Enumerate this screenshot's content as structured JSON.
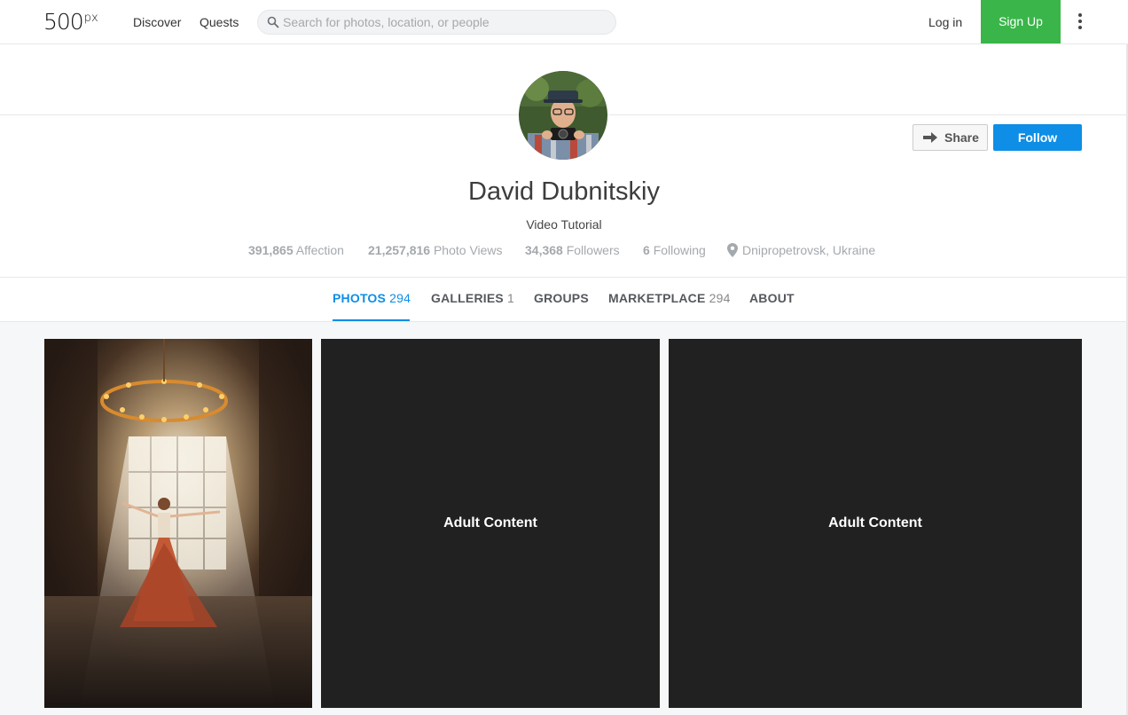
{
  "nav": {
    "logo": "500",
    "logo_sup": "px",
    "discover": "Discover",
    "quests": "Quests",
    "search_placeholder": "Search for photos, location, or people",
    "login": "Log in",
    "signup": "Sign Up"
  },
  "profile": {
    "name": "David Dubnitskiy",
    "subtitle": "Video Tutorial",
    "share_label": "Share",
    "follow_label": "Follow",
    "stats": {
      "affection_value": "391,865",
      "affection_label": "Affection",
      "views_value": "21,257,816",
      "views_label": "Photo Views",
      "followers_value": "34,368",
      "followers_label": "Followers",
      "following_value": "6",
      "following_label": "Following",
      "location": "Dnipropetrovsk, Ukraine"
    }
  },
  "tabs": [
    {
      "label": "PHOTOS",
      "count": "294"
    },
    {
      "label": "GALLERIES",
      "count": "1"
    },
    {
      "label": "GROUPS",
      "count": ""
    },
    {
      "label": "MARKETPLACE",
      "count": "294"
    },
    {
      "label": "ABOUT",
      "count": ""
    }
  ],
  "photos": [
    {
      "label": ""
    },
    {
      "label": "Adult Content"
    },
    {
      "label": "Adult Content"
    }
  ],
  "colors": {
    "accent": "#0e8ee6",
    "signup": "#3ab54a",
    "tile_dark": "#212121"
  }
}
